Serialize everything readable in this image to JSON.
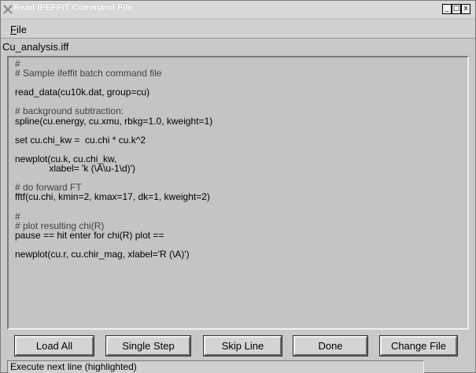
{
  "window": {
    "title": "Read IFEFFIT Command File",
    "controls": {
      "minimize": "_",
      "maximize": "□",
      "close": "x"
    }
  },
  "menubar": {
    "file_label_first": "F",
    "file_label_rest": "ile"
  },
  "file_label": "Cu_analysis.iff",
  "code_lines": [
    {
      "text": "#",
      "comment": true
    },
    {
      "text": "# Sample ifeffit batch command file",
      "comment": true
    },
    {
      "text": "",
      "comment": false
    },
    {
      "text": "read_data(cu10k.dat, group=cu)",
      "comment": false
    },
    {
      "text": "",
      "comment": false
    },
    {
      "text": "# background subtraction:",
      "comment": true
    },
    {
      "text": "spline(cu.energy, cu.xmu, rbkg=1.0, kweight=1)",
      "comment": false
    },
    {
      "text": "",
      "comment": false
    },
    {
      "text": "set cu.chi_kw =  cu.chi * cu.k^2",
      "comment": false
    },
    {
      "text": "",
      "comment": false
    },
    {
      "text": "newplot(cu.k, cu.chi_kw,",
      "comment": false
    },
    {
      "text": "             xlabel= 'k (\\A\\u-1\\d)')",
      "comment": false
    },
    {
      "text": "",
      "comment": false
    },
    {
      "text": "# do forward FT",
      "comment": true
    },
    {
      "text": "fftf(cu.chi, kmin=2, kmax=17, dk=1, kweight=2)",
      "comment": false
    },
    {
      "text": "",
      "comment": false
    },
    {
      "text": "#",
      "comment": true
    },
    {
      "text": "# plot resulting chi(R)",
      "comment": true
    },
    {
      "text": "pause == hit enter for chi(R) plot ==",
      "comment": false
    },
    {
      "text": "",
      "comment": false
    },
    {
      "text": "newplot(cu.r, cu.chir_mag, xlabel='R (\\A)')",
      "comment": false
    }
  ],
  "buttons": {
    "load_all": "Load All",
    "single_step": "Single Step",
    "skip_line": "Skip Line",
    "done": "Done",
    "change_file": "Change File"
  },
  "status": "Execute next line (highlighted)",
  "colors": {
    "window_bg": "#c8c8c8",
    "text_panel_bg": "#c4c4c4",
    "title_text": "#ffffff"
  }
}
